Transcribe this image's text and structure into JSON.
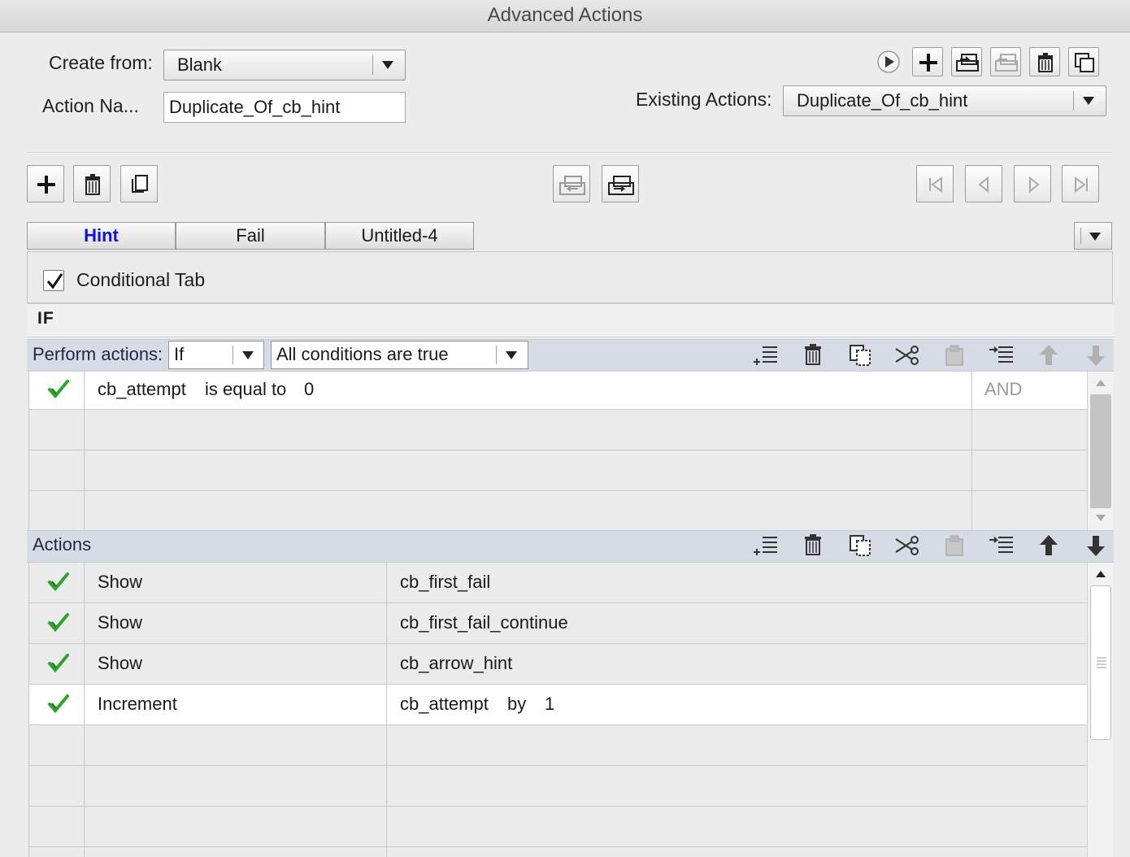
{
  "window": {
    "title": "Advanced Actions"
  },
  "header": {
    "create_from_label": "Create from:",
    "create_from_value": "Blank",
    "action_name_label": "Action Na...",
    "action_name_value": "Duplicate_Of_cb_hint",
    "existing_actions_label": "Existing Actions:",
    "existing_actions_value": "Duplicate_Of_cb_hint"
  },
  "top_toolbar": {
    "icons": [
      "preview-icon",
      "add-action-icon",
      "import-icon",
      "export-icon",
      "delete-icon",
      "duplicate-icon"
    ]
  },
  "decision_toolbar": {
    "icons": [
      "add-decision-icon",
      "delete-decision-icon",
      "copy-decision-icon",
      "insert-decision-left-icon",
      "insert-decision-right-icon",
      "first-decision-icon",
      "previous-decision-icon",
      "next-decision-icon",
      "last-decision-icon"
    ]
  },
  "tabs": [
    {
      "label": "Hint",
      "active": true
    },
    {
      "label": "Fail",
      "active": false
    },
    {
      "label": "Untitled-4",
      "active": false
    }
  ],
  "conditional": {
    "checkbox_label": "Conditional Tab",
    "checked": true,
    "if_header": "IF"
  },
  "conditions": {
    "perform_label": "Perform actions:",
    "perform_value": "If",
    "match_value": "All conditions are true",
    "rows": [
      {
        "variable": "cb_attempt",
        "operator": "is equal to",
        "value": "0",
        "logic": "AND"
      }
    ],
    "empty_rows": 3
  },
  "actions": {
    "header": "Actions",
    "rows": [
      {
        "action": "Show",
        "target": "cb_first_fail",
        "extra": "",
        "amount": ""
      },
      {
        "action": "Show",
        "target": "cb_first_fail_continue",
        "extra": "",
        "amount": ""
      },
      {
        "action": "Show",
        "target": "cb_arrow_hint",
        "extra": "",
        "amount": ""
      },
      {
        "action": "Increment",
        "target": "cb_attempt",
        "extra": "by",
        "amount": "1"
      }
    ],
    "empty_rows": 4
  },
  "colors": {
    "active_tab_text": "#1010e0",
    "check_green": "#2ea32e",
    "bar_background": "#d6dbe6"
  }
}
